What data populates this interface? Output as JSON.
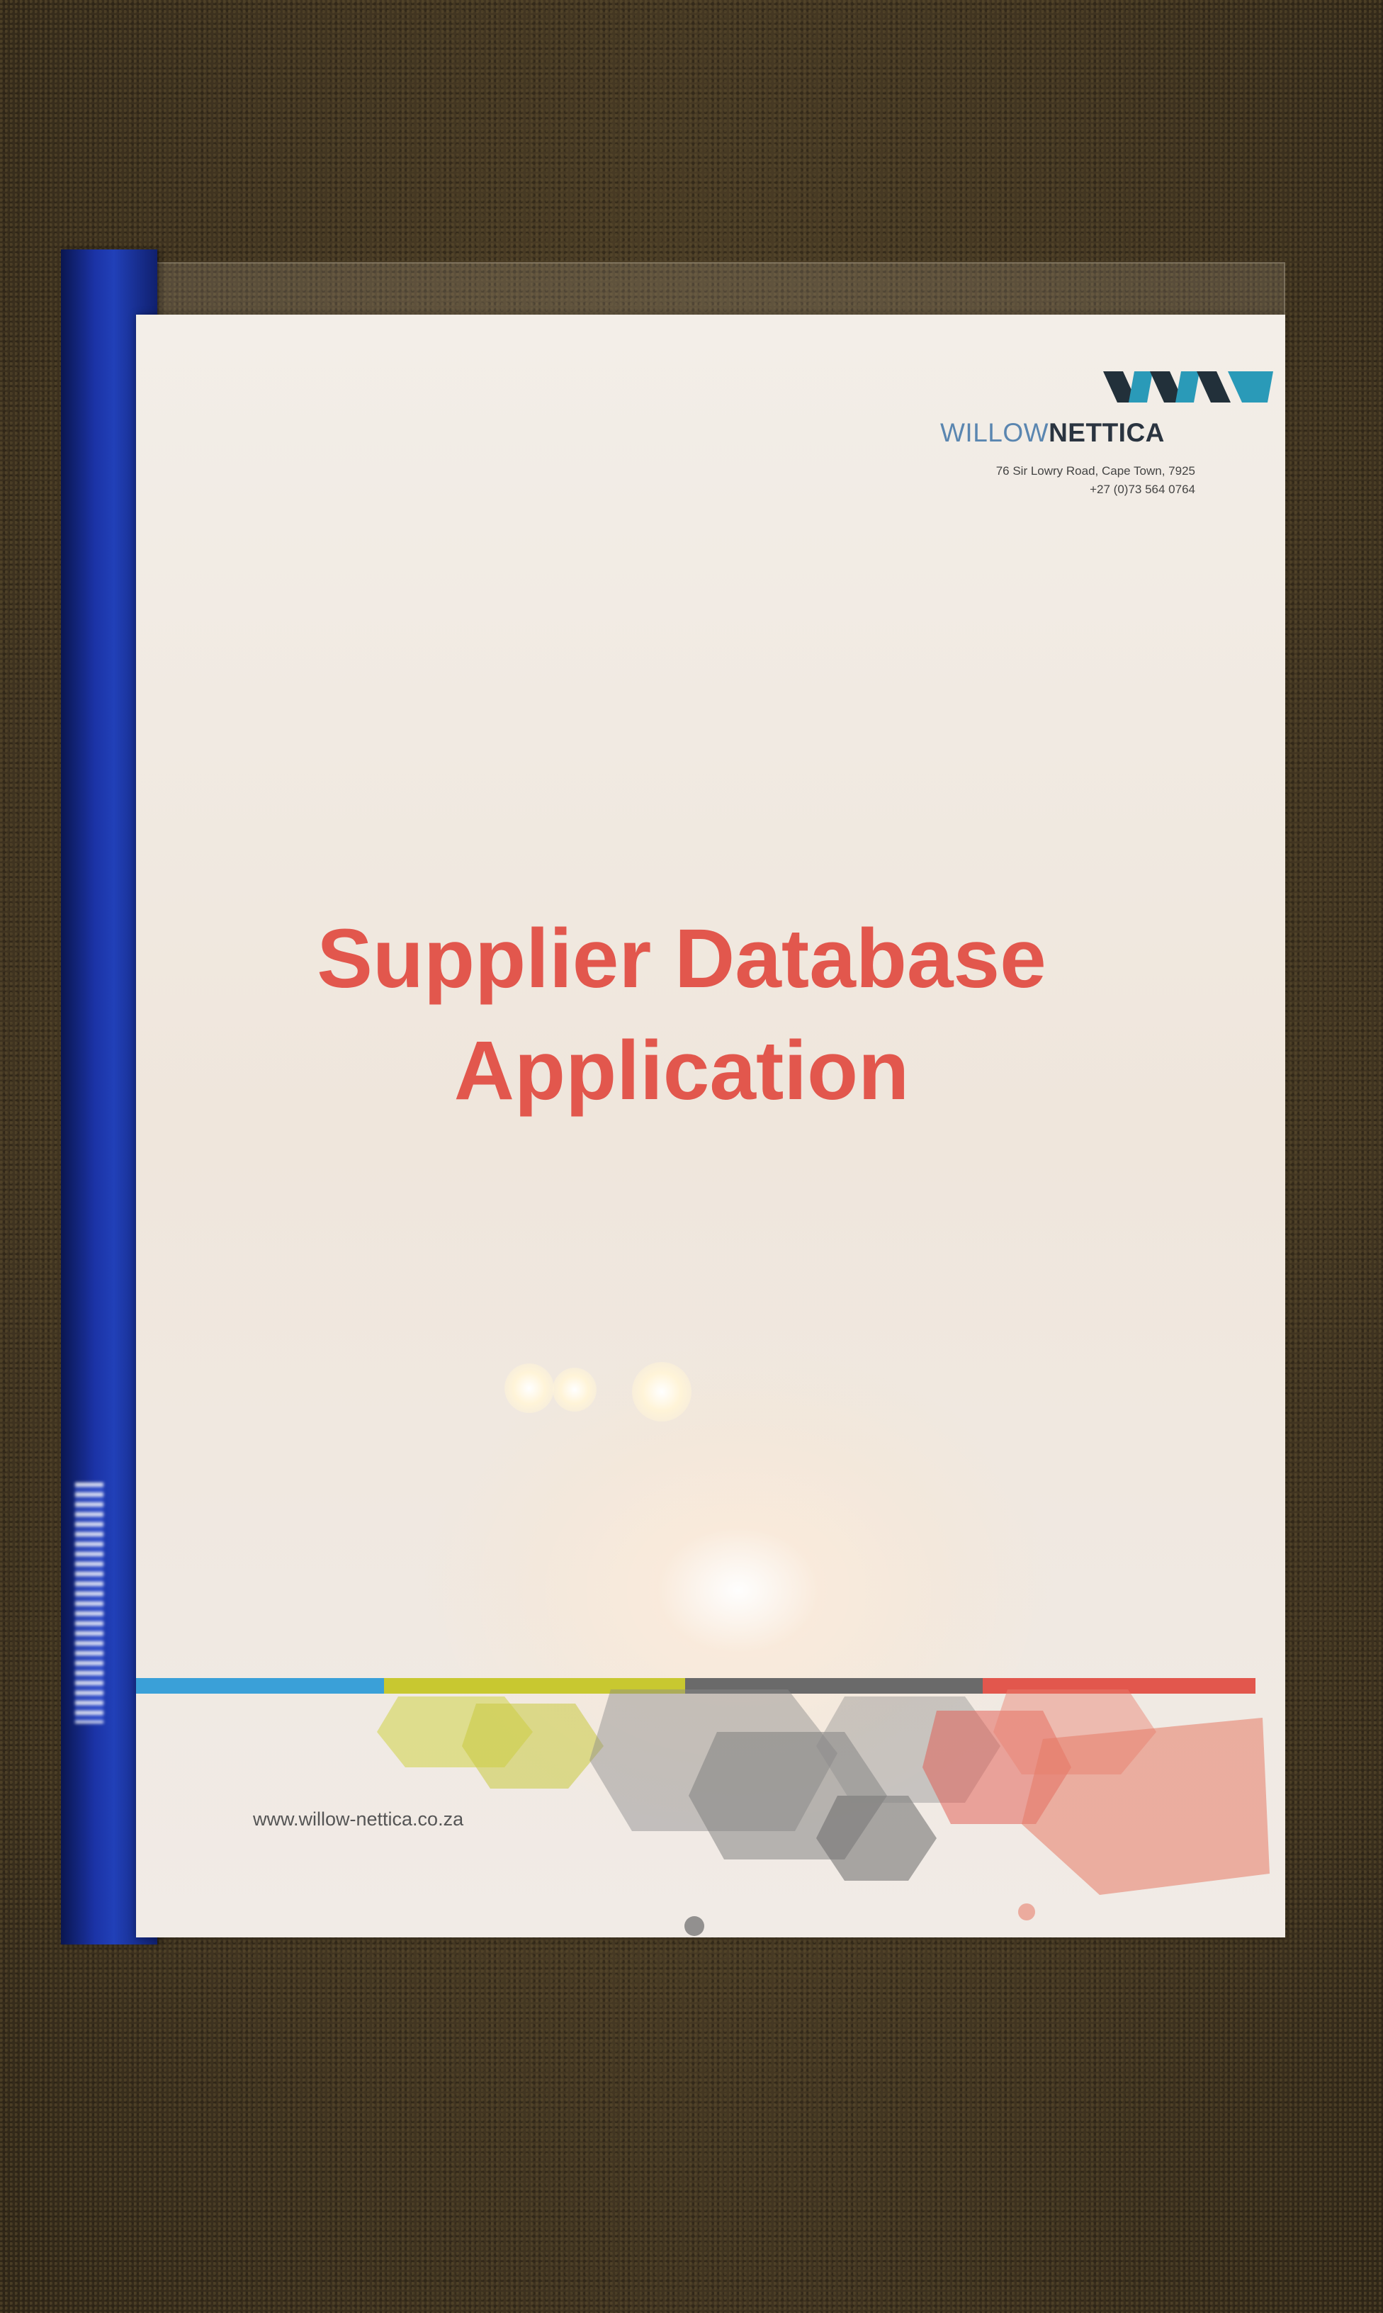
{
  "company": {
    "name_light": "WILLOW",
    "name_bold": "NETTICA",
    "address_line1": "76 Sir Lowry Road, Cape Town, 7925",
    "address_line2": "+27 (0)73 564 0764",
    "website": "www.willow-nettica.co.za"
  },
  "document": {
    "title_line1": "Supplier Database",
    "title_line2": "Application"
  },
  "colors": {
    "title": "#e2574d",
    "logo_dark": "#22303a",
    "logo_teal": "#2a9ab8",
    "bar_blue": "#3aa0d8",
    "bar_yellow": "#c8c830",
    "bar_gray": "#6a6a6a",
    "bar_red": "#e2574d",
    "spine": "#1b33a6"
  }
}
